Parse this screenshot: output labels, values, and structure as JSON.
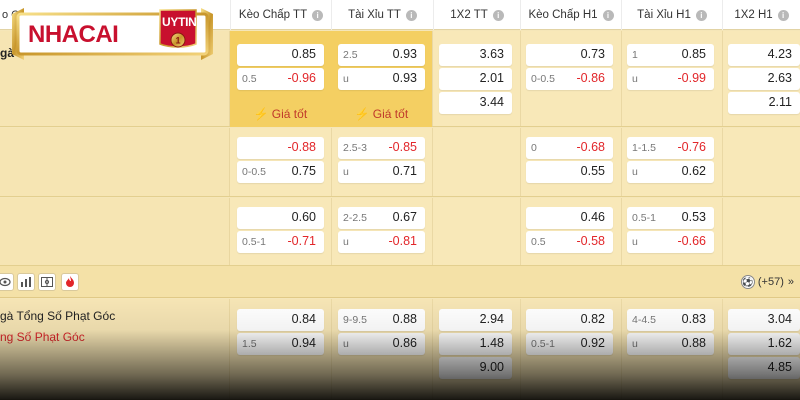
{
  "logo": {
    "text_main": "NHACAI",
    "text_accent": "UYTIN"
  },
  "header": {
    "left_label": "o C",
    "columns": [
      "Kèo Chấp TT",
      "Tài Xỉu TT",
      "1X2 TT",
      "Kèo Chấp H1",
      "Tài Xỉu H1",
      "1X2 H1"
    ]
  },
  "left_stub": "gà",
  "best_price_label": "Giá tốt",
  "rows": [
    {
      "hdp_tt": [
        {
          "line": "",
          "val": "0.85"
        },
        {
          "line": "0.5",
          "val": "-0.96"
        }
      ],
      "ou_tt": [
        {
          "line": "2.5",
          "val": "0.93"
        },
        {
          "line": "u",
          "val": "0.93"
        }
      ],
      "x12_tt": [
        "3.63",
        "2.01",
        "3.44"
      ],
      "hdp_h1": [
        {
          "line": "",
          "val": "0.73"
        },
        {
          "line": "0-0.5",
          "val": "-0.86"
        }
      ],
      "ou_h1": [
        {
          "line": "1",
          "val": "0.85"
        },
        {
          "line": "u",
          "val": "-0.99"
        }
      ],
      "x12_h1": [
        "4.23",
        "2.63",
        "2.11"
      ]
    },
    {
      "hdp_tt": [
        {
          "line": "",
          "val": "-0.88"
        },
        {
          "line": "0-0.5",
          "val": "0.75"
        }
      ],
      "ou_tt": [
        {
          "line": "2.5-3",
          "val": "-0.85"
        },
        {
          "line": "u",
          "val": "0.71"
        }
      ],
      "hdp_h1": [
        {
          "line": "0",
          "val": "-0.68"
        },
        {
          "line": "",
          "val": "0.55"
        }
      ],
      "ou_h1": [
        {
          "line": "1-1.5",
          "val": "-0.76"
        },
        {
          "line": "u",
          "val": "0.62"
        }
      ]
    },
    {
      "hdp_tt": [
        {
          "line": "",
          "val": "0.60"
        },
        {
          "line": "0.5-1",
          "val": "-0.71"
        }
      ],
      "ou_tt": [
        {
          "line": "2-2.5",
          "val": "0.67"
        },
        {
          "line": "u",
          "val": "-0.81"
        }
      ],
      "hdp_h1": [
        {
          "line": "",
          "val": "0.46"
        },
        {
          "line": "0.5",
          "val": "-0.58"
        }
      ],
      "ou_h1": [
        {
          "line": "0.5-1",
          "val": "0.53"
        },
        {
          "line": "u",
          "val": "-0.66"
        }
      ]
    }
  ],
  "toolbar": {
    "more_label": "(+57)",
    "chevron": "»"
  },
  "corners": {
    "market_name_1": "gà Tổng Số Phạt Góc",
    "market_name_2": "ng Số Phạt Góc",
    "hdp_tt": [
      {
        "line": "",
        "val": "0.84"
      },
      {
        "line": "1.5",
        "val": "0.94"
      }
    ],
    "ou_tt": [
      {
        "line": "9-9.5",
        "val": "0.88"
      },
      {
        "line": "u",
        "val": "0.86"
      }
    ],
    "x12_tt": [
      "2.94",
      "1.48",
      "9.00"
    ],
    "hdp_h1": [
      {
        "line": "",
        "val": "0.82"
      },
      {
        "line": "0.5-1",
        "val": "0.92"
      }
    ],
    "ou_h1": [
      {
        "line": "4-4.5",
        "val": "0.83"
      },
      {
        "line": "u",
        "val": "0.88"
      }
    ],
    "x12_h1": [
      "3.04",
      "1.62",
      "4.85"
    ]
  },
  "colors": {
    "accent": "#f4cf62",
    "negative": "#e2262a",
    "row_bg": "#f8e8b8"
  }
}
